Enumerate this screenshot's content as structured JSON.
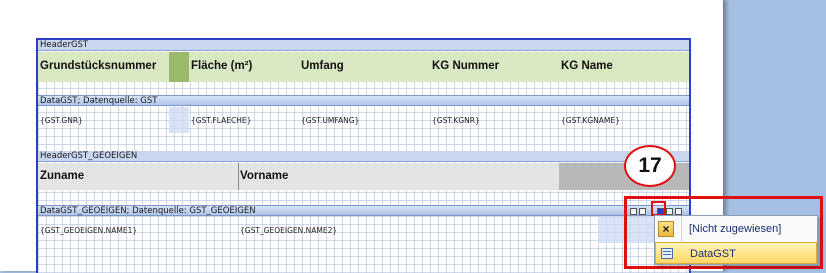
{
  "bands": {
    "header_gst": {
      "title": "HeaderGST",
      "columns": [
        "Grundstücksnummer",
        "Fläche (m²)",
        "Umfang",
        "KG Nummer",
        "KG Name"
      ]
    },
    "data_gst": {
      "title": "DataGST; Datenquelle: GST",
      "fields": [
        "{GST.GNR}",
        "{GST.FLAECHE}",
        "{GST.UMFANG}",
        "{GST.KGNR}",
        "{GST.KGNAME}"
      ]
    },
    "header_gst_geoeigen": {
      "title": "HeaderGST_GEOEIGEN",
      "columns": [
        "Zuname",
        "Vorname"
      ]
    },
    "data_gst_geoeigen": {
      "title": "DataGST_GEOEIGEN; Datenquelle: GST_GEOEIGEN",
      "fields": [
        "{GST_GEOEIGEN.NAME1}",
        "{GST_GEOEIGEN.NAME2}"
      ]
    }
  },
  "callout": {
    "number": "17"
  },
  "dropdown": {
    "items": [
      {
        "label": "[Nicht zugewiesen]",
        "icon": "close-x-icon"
      },
      {
        "label": "DataGST",
        "icon": "databand-icon",
        "selected": true
      }
    ]
  },
  "colors": {
    "accent_red": "#e01010",
    "band_border": "#2d3fc4",
    "header_green": "#d9e7c2",
    "selected_item": "#ffd866"
  }
}
